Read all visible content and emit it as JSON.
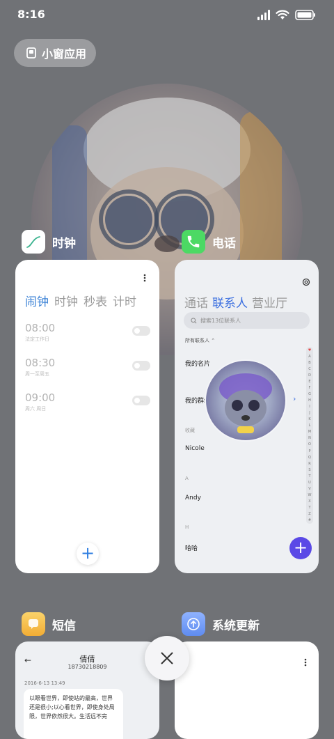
{
  "status_bar": {
    "time": "8:16"
  },
  "floating_windows": {
    "label": "小窗应用"
  },
  "apps": {
    "clock": {
      "name": "时钟",
      "tabs": [
        "闹钟",
        "时钟",
        "秒表",
        "计时"
      ],
      "alarms": [
        {
          "time": "08:00",
          "repeat": "法定工作日"
        },
        {
          "time": "08:30",
          "repeat": "周一至周五"
        },
        {
          "time": "09:00",
          "repeat": "周六 周日"
        }
      ],
      "add_label": "+"
    },
    "phone": {
      "name": "电话",
      "tabs": [
        "通话",
        "联系人",
        "营业厅"
      ],
      "search_placeholder": "搜索13位联系人",
      "filter": "所有联系人",
      "my_card": "我的名片",
      "my_groups": "我的群组",
      "favorites_header": "收藏",
      "contacts": [
        {
          "section": "",
          "name": "Nicole"
        },
        {
          "section": "A",
          "name": "Andy"
        },
        {
          "section": "H",
          "name": "哈哈"
        }
      ],
      "alpha_index": [
        "♥",
        "A",
        "B",
        "C",
        "D",
        "E",
        "F",
        "G",
        "H",
        "I",
        "J",
        "K",
        "L",
        "M",
        "N",
        "O",
        "P",
        "Q",
        "R",
        "S",
        "T",
        "U",
        "V",
        "W",
        "X",
        "Y",
        "Z",
        "#"
      ],
      "add_label": "+"
    },
    "messages": {
      "name": "短信",
      "contact_name": "倩倩",
      "contact_number": "18730218809",
      "date": "2016-6-13 13:49",
      "message_text": "以眼看世界，即使站的最高，世界还是很小;以心看世界，即使身处局限，世界依然很大。生活远不完"
    },
    "update": {
      "name": "系统更新"
    }
  },
  "colors": {
    "background": "#707276",
    "clock_accent": "#3b82d6",
    "phone_accent": "#3b6fe0",
    "phone_add": "#5a49e6",
    "phone_icon": "#4cd964",
    "sms_icon": "#f7c04a",
    "update_icon": "#5f8cf0"
  }
}
